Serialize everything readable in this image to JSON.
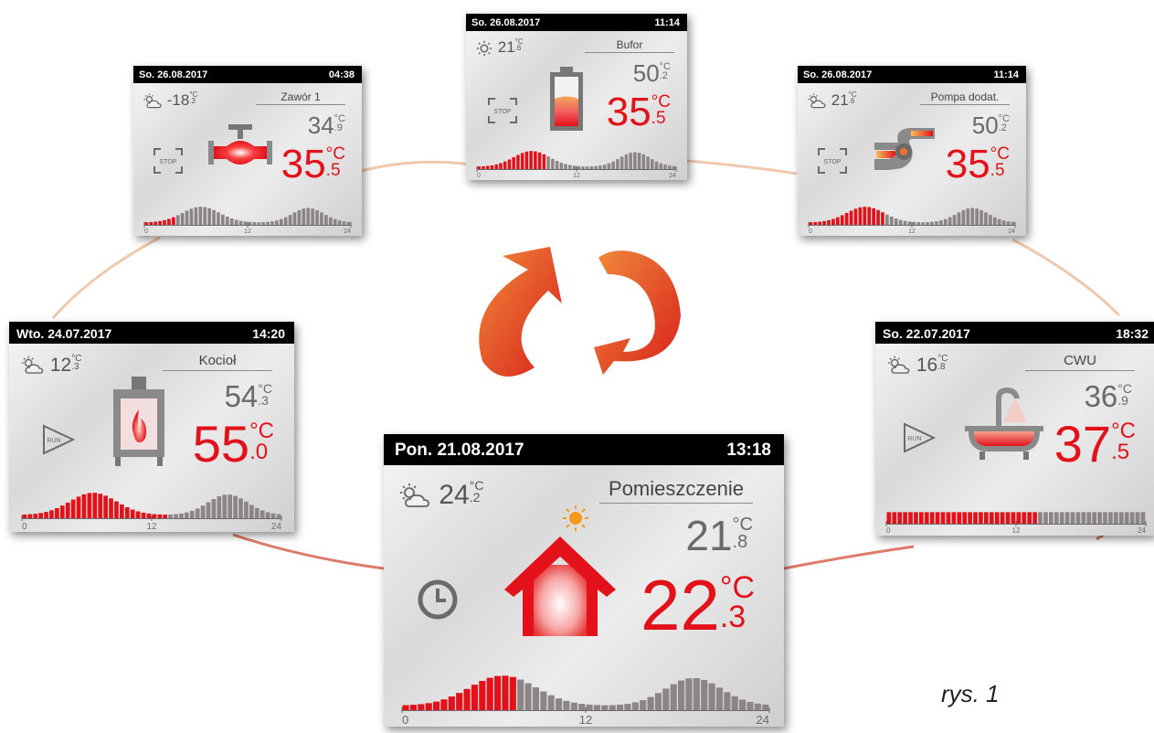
{
  "panels": {
    "main": {
      "date": "Pon. 21.08.2017",
      "time": "13:18",
      "outdoor_int": "24",
      "outdoor_dec": ".2",
      "title": "Pomieszczenie",
      "set_int": "21",
      "set_dec": ".8",
      "cur_int": "22",
      "cur_dec": ".3",
      "unit": "°C",
      "ticks": [
        "0",
        "12",
        "24"
      ],
      "mode": "clock-icon",
      "device": "house-icon"
    },
    "zawor": {
      "date": "So. 26.08.2017",
      "time": "04:38",
      "outdoor_int": "-18",
      "outdoor_dec": ".3",
      "title": "Zawór 1",
      "set_int": "34",
      "set_dec": ".9",
      "cur_int": "35",
      "cur_dec": ".5",
      "unit": "°C",
      "ticks": [
        "0",
        "12",
        "24"
      ],
      "mode_label": "STOP",
      "device": "valve-icon"
    },
    "bufor": {
      "date": "So. 26.08.2017",
      "time": "11:14",
      "outdoor_int": "21",
      "outdoor_dec": ".6",
      "title": "Bufor",
      "set_int": "50",
      "set_dec": ".2",
      "cur_int": "35",
      "cur_dec": ".5",
      "unit": "°C",
      "ticks": [
        "0",
        "12",
        "24"
      ],
      "mode_label": "STOP",
      "device": "battery-icon"
    },
    "pompa": {
      "date": "So. 26.08.2017",
      "time": "11:14",
      "outdoor_int": "21",
      "outdoor_dec": ".6",
      "title": "Pompa dodat.",
      "set_int": "50",
      "set_dec": ".2",
      "cur_int": "35",
      "cur_dec": ".5",
      "unit": "°C",
      "ticks": [
        "0",
        "12",
        "24"
      ],
      "mode_label": "STOP",
      "device": "pump-icon"
    },
    "kociol": {
      "date": "Wto. 24.07.2017",
      "time": "14:20",
      "outdoor_int": "12",
      "outdoor_dec": ".3",
      "title": "Kocioł",
      "set_int": "54",
      "set_dec": ".3",
      "cur_int": "55",
      "cur_dec": ".0",
      "unit": "°C",
      "ticks": [
        "0",
        "12",
        "24"
      ],
      "mode_label": "RUN",
      "device": "stove-icon"
    },
    "cwu": {
      "date": "So. 22.07.2017",
      "time": "18:32",
      "outdoor_int": "16",
      "outdoor_dec": ".8",
      "title": "CWU",
      "set_int": "36",
      "set_dec": ".9",
      "cur_int": "37",
      "cur_dec": ".5",
      "unit": "°C",
      "ticks": [
        "0",
        "12",
        "24"
      ],
      "mode_label": "RUN",
      "device": "bathtub-icon"
    }
  },
  "caption": "rys. 1",
  "colors": {
    "accent_red": "#e3121a",
    "setpoint_gray": "#6a6a6a",
    "bar_gray": "#8c8585",
    "header_black": "#000000"
  }
}
